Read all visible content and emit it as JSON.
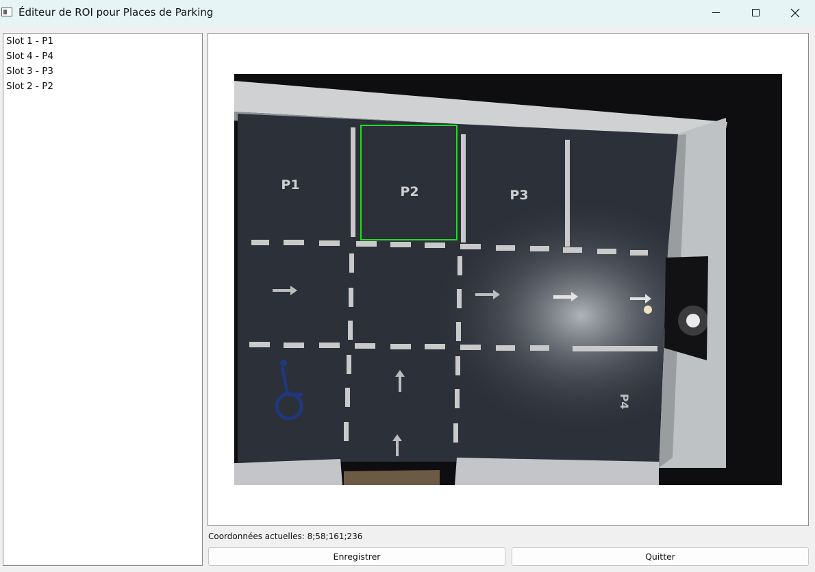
{
  "window": {
    "title": "Éditeur de ROI pour Places de Parking",
    "minimize_label": "—",
    "maximize_label": "□",
    "close_label": "✕"
  },
  "slots": {
    "items": [
      {
        "label": "Slot 1 - P1"
      },
      {
        "label": "Slot 4 - P4"
      },
      {
        "label": "Slot 3 - P3"
      },
      {
        "label": "Slot 2 - P2"
      }
    ]
  },
  "image": {
    "space_labels": [
      "P1",
      "P2",
      "P3",
      "P4"
    ],
    "roi_color": "#22dd22"
  },
  "status": {
    "coordinates": "Coordonnées actuelles: 8;58;161;236"
  },
  "buttons": {
    "save_label": "Enregistrer",
    "quit_label": "Quitter"
  }
}
